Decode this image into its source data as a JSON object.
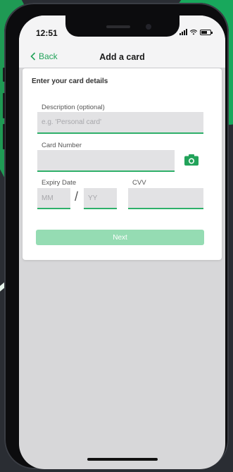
{
  "status": {
    "time": "12:51"
  },
  "nav": {
    "back_label": "Back",
    "title": "Add a card"
  },
  "form": {
    "heading": "Enter your card details",
    "description": {
      "label": "Description (optional)",
      "placeholder": "e.g. 'Personal card'",
      "value": ""
    },
    "card_number": {
      "label": "Card Number",
      "value": ""
    },
    "expiry": {
      "label": "Expiry Date",
      "month_placeholder": "MM",
      "year_placeholder": "YY",
      "separator": "/"
    },
    "cvv": {
      "label": "CVV",
      "value": ""
    },
    "next_label": "Next"
  },
  "colors": {
    "accent": "#22a35a",
    "next_disabled": "#95dcb3",
    "field_bg": "#e2e2e4"
  }
}
